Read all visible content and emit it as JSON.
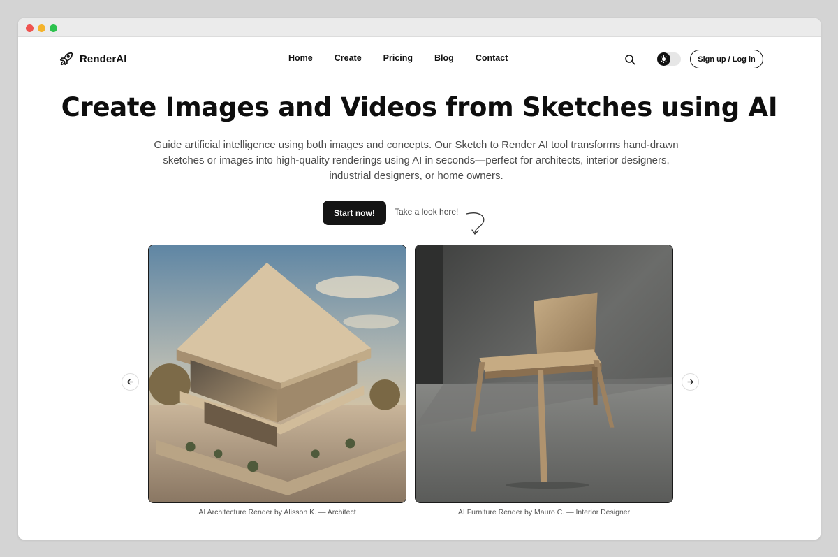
{
  "brand": {
    "name": "RenderAI",
    "logo_icon": "rocket-icon"
  },
  "nav": {
    "items": [
      {
        "label": "Home"
      },
      {
        "label": "Create"
      },
      {
        "label": "Pricing"
      },
      {
        "label": "Blog"
      },
      {
        "label": "Contact"
      }
    ]
  },
  "header": {
    "search_icon": "search-icon",
    "theme_toggle_icon": "sun-icon",
    "signup_label": "Sign up / Log in"
  },
  "hero": {
    "title": "Create Images and Videos from Sketches using AI",
    "subtitle": "Guide artificial intelligence using both images and concepts. Our Sketch to Render AI tool transforms hand-drawn sketches or images into high-quality renderings using AI in seconds—perfect for architects, interior designers, industrial designers, or home owners.",
    "cta_label": "Start now!",
    "hint_label": "Take a look here!"
  },
  "gallery": {
    "items": [
      {
        "caption": "AI Architecture Render by Alisson K. — Architect"
      },
      {
        "caption": "AI Furniture Render by Mauro C. — Interior Designer"
      }
    ],
    "prev_icon": "arrow-left-icon",
    "next_icon": "arrow-right-icon"
  },
  "colors": {
    "primary_button": "#151515",
    "text": "#111111",
    "muted": "#4a4a4a",
    "window_bg": "#d4d4d4"
  }
}
